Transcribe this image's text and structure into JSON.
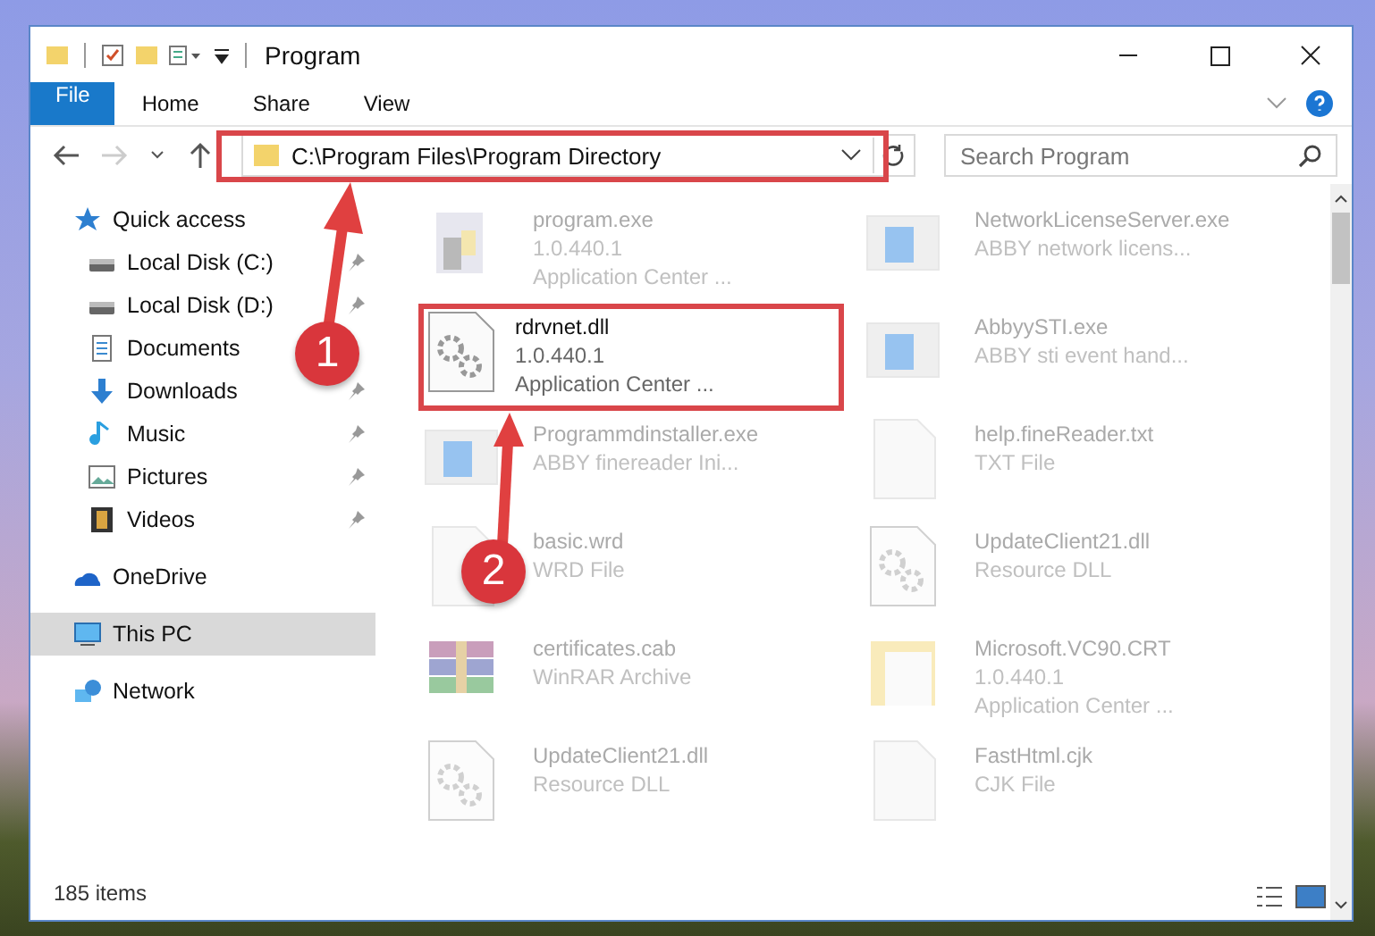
{
  "window": {
    "title": "Program"
  },
  "ribbon_tabs": [
    {
      "label": "File",
      "selected": true
    },
    {
      "label": "Home",
      "selected": false
    },
    {
      "label": "Share",
      "selected": false
    },
    {
      "label": "View",
      "selected": false
    }
  ],
  "address": {
    "path": "C:\\Program Files\\Program Directory"
  },
  "search": {
    "placeholder": "Search Program"
  },
  "sidebar": {
    "items": [
      {
        "label": "Quick access",
        "selected": false,
        "children": [
          {
            "label": "Local Disk (C:)",
            "pinned": true,
            "selected": false
          },
          {
            "label": "Local Disk (D:)",
            "pinned": true,
            "selected": false
          },
          {
            "label": "Documents",
            "pinned": false,
            "selected": false
          },
          {
            "label": "Downloads",
            "pinned": true,
            "selected": false
          },
          {
            "label": "Music",
            "pinned": true,
            "selected": false
          },
          {
            "label": "Pictures",
            "pinned": true,
            "selected": false
          },
          {
            "label": "Videos",
            "pinned": true,
            "selected": false
          }
        ]
      },
      {
        "label": "OneDrive",
        "selected": false
      },
      {
        "label": "This PC",
        "selected": true
      },
      {
        "label": "Network",
        "selected": false
      }
    ]
  },
  "files": [
    {
      "kind": "exe",
      "name": "program.exe",
      "lines": [
        "1.0.440.1",
        "Application Center ..."
      ],
      "faded": true
    },
    {
      "kind": "app",
      "name": "NetworkLicenseServer.exe",
      "lines": [
        "ABBY network licens..."
      ],
      "faded": true
    },
    {
      "kind": "dll",
      "name": "rdrvnet.dll",
      "lines": [
        "1.0.440.1",
        "Application Center ..."
      ],
      "faded": false
    },
    {
      "kind": "app",
      "name": "AbbyySTI.exe",
      "lines": [
        "ABBY sti event hand..."
      ],
      "faded": true
    },
    {
      "kind": "app",
      "name": "Programmdinstaller.exe",
      "lines": [
        "ABBY finereader Ini..."
      ],
      "faded": true
    },
    {
      "kind": "txt",
      "name": "help.fineReader.txt",
      "lines": [
        "TXT File"
      ],
      "faded": true
    },
    {
      "kind": "txt",
      "name": "basic.wrd",
      "lines": [
        "WRD File"
      ],
      "faded": true
    },
    {
      "kind": "dll",
      "name": "UpdateClient21.dll",
      "lines": [
        "Resource DLL"
      ],
      "faded": true
    },
    {
      "kind": "cab",
      "name": "certificates.cab",
      "lines": [
        "WinRAR Archive"
      ],
      "faded": true
    },
    {
      "kind": "folder",
      "name": "Microsoft.VC90.CRT",
      "lines": [
        "1.0.440.1",
        "Application Center ..."
      ],
      "faded": true
    },
    {
      "kind": "dll",
      "name": "UpdateClient21.dll",
      "lines": [
        "Resource DLL"
      ],
      "faded": true
    },
    {
      "kind": "txt",
      "name": "FastHtml.cjk",
      "lines": [
        "CJK File"
      ],
      "faded": true
    }
  ],
  "status_bar": {
    "count": "185 items"
  },
  "callouts": [
    {
      "number": "1"
    },
    {
      "number": "2"
    }
  ]
}
